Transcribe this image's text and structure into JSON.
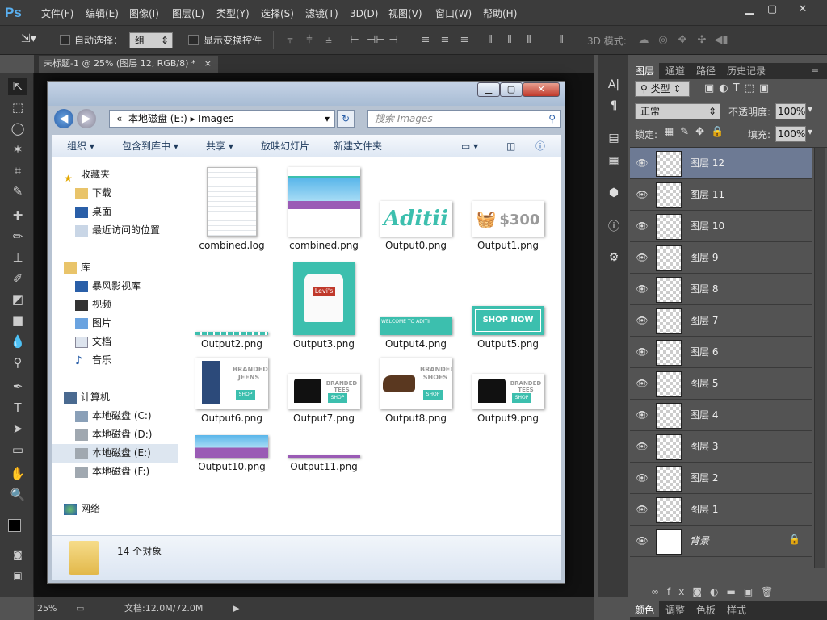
{
  "app": {
    "logo": "Ps"
  },
  "menu": {
    "items": [
      "文件(F)",
      "编辑(E)",
      "图像(I)",
      "图层(L)",
      "类型(Y)",
      "选择(S)",
      "滤镜(T)",
      "3D(D)",
      "视图(V)",
      "窗口(W)",
      "帮助(H)"
    ]
  },
  "options": {
    "auto_select_label": "自动选择：",
    "auto_select_value": "组",
    "show_transform_label": "显示变换控件",
    "mode3d_label": "3D 模式:"
  },
  "document": {
    "tab_title": "未标题-1 @ 25% (图层 12, RGB/8) *",
    "zoom": "25%",
    "doc_size": "文档:12.0M/72.0M"
  },
  "explorer": {
    "address_prefix": "«",
    "address_parts": [
      "本地磁盘 (E:)",
      "Images"
    ],
    "search_placeholder": "搜索 Images",
    "toolbar": [
      "组织",
      "包含到库中",
      "共享",
      "放映幻灯片",
      "新建文件夹"
    ],
    "nav": {
      "favorites": "收藏夹",
      "fav_items": [
        "下载",
        "桌面",
        "最近访问的位置"
      ],
      "libraries": "库",
      "lib_items": [
        "暴风影视库",
        "视频",
        "图片",
        "文档",
        "音乐"
      ],
      "computer": "计算机",
      "drives": [
        "本地磁盘 (C:)",
        "本地磁盘 (D:)",
        "本地磁盘 (E:)",
        "本地磁盘 (F:)"
      ],
      "network": "网络"
    },
    "files": [
      "combined.log",
      "combined.png",
      "Output0.png",
      "Output1.png",
      "Output2.png",
      "Output3.png",
      "Output4.png",
      "Output5.png",
      "Output6.png",
      "Output7.png",
      "Output8.png",
      "Output9.png",
      "Output10.png",
      "Output11.png"
    ],
    "thumb_text": {
      "aditii": "Aditii",
      "price": "$300",
      "levis": "Levi's",
      "welcome": "WELCOME TO ADITII",
      "shopnow": "SHOP NOW",
      "branded_jeens": "BRANDED JEENS",
      "branded_tees": "BRANDED TEES",
      "branded_shoes": "BRANDED SHOES",
      "shop": "SHOP"
    },
    "status": "14 个对象"
  },
  "layers_panel": {
    "tabs": [
      "图层",
      "通道",
      "路径",
      "历史记录"
    ],
    "kind_filter": "类型",
    "blend_mode": "正常",
    "opacity_label": "不透明度:",
    "opacity_value": "100%",
    "lock_label": "锁定:",
    "fill_label": "填充:",
    "fill_value": "100%",
    "layers": [
      "图层 12",
      "图层 11",
      "图层 10",
      "图层 9",
      "图层 8",
      "图层 7",
      "图层 6",
      "图层 5",
      "图层 4",
      "图层 3",
      "图层 2",
      "图层 1",
      "背景"
    ],
    "selected": "图层 12",
    "bottom_tabs": [
      "颜色",
      "调整",
      "色板",
      "样式"
    ]
  },
  "colors": {
    "accent_teal": "#3cbfae",
    "selection": "#6d7a94",
    "ps_blue": "#5ab0f0"
  }
}
